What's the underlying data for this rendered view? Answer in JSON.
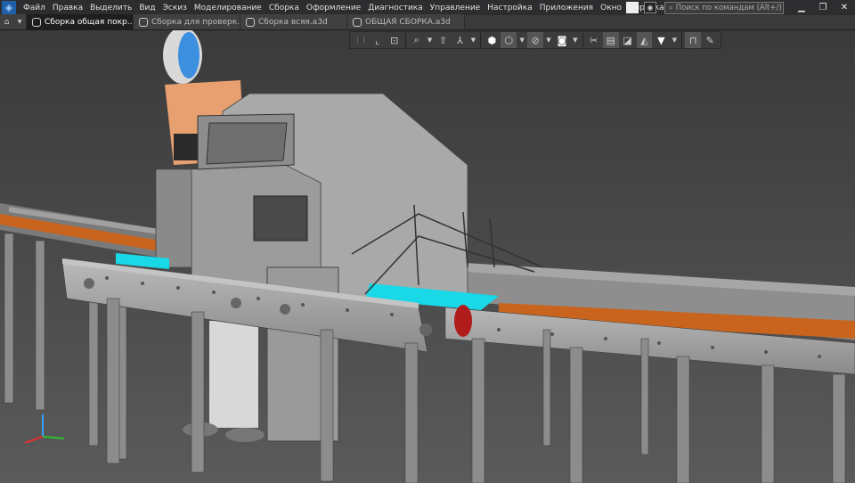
{
  "menu": [
    "Файл",
    "Правка",
    "Выделить",
    "Вид",
    "Эскиз",
    "Моделирование",
    "Сборка",
    "Оформление",
    "Диагностика",
    "Управление",
    "Настройка",
    "Приложения",
    "Окно",
    "Справка"
  ],
  "search": {
    "placeholder": "Поиск по командам (Alt+/)"
  },
  "tabs": [
    {
      "label": "Сборка общая покр...",
      "active": true
    },
    {
      "label": "Сборка для проверк..."
    },
    {
      "label": "Сборка всяя.a3d"
    },
    {
      "label": "ОБЩАЯ СБОРКА.a3d"
    }
  ],
  "toolbar": [
    "grid",
    "orient",
    "view-normal",
    "zoom",
    "zoom-dd",
    "move",
    "axes",
    "axes-dd",
    "display-shaded",
    "display-wire",
    "wire-dd",
    "hide",
    "hide-dd",
    "section",
    "section-dd",
    "explode",
    "frame",
    "appearance",
    "layers",
    "filter",
    "filter-dd",
    "measure",
    "pipette"
  ],
  "colors": {
    "accent": "#1f5fa8",
    "belt": "#c8641e",
    "cyan": "#19d8e8",
    "background": "#4a4a4a"
  }
}
